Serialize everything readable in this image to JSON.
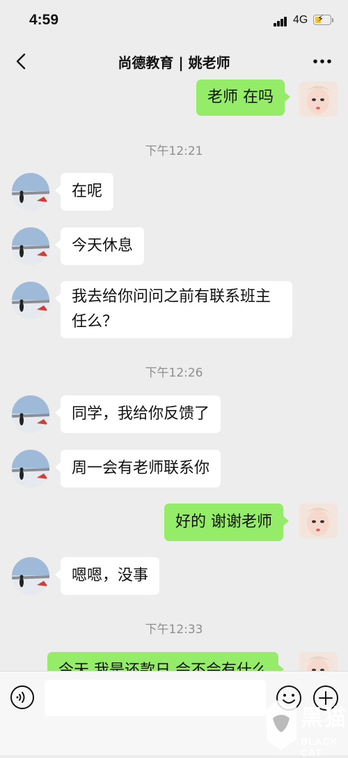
{
  "status_bar": {
    "time": "4:59",
    "network": "4G"
  },
  "nav": {
    "title": "尚德教育 | 姚老师",
    "back_icon": "chevron-left-icon",
    "more_icon": "more-dots-icon"
  },
  "messages": [
    {
      "side": "right",
      "text": "老师 在吗"
    },
    {
      "timestamp": "下午12:21"
    },
    {
      "side": "left",
      "text": "在呢"
    },
    {
      "side": "left",
      "text": "今天休息"
    },
    {
      "side": "left",
      "text_lines": [
        "我去给你问问之前有联系班主",
        "任么？"
      ]
    },
    {
      "timestamp": "下午12:26"
    },
    {
      "side": "left",
      "text": "同学，我给你反馈了"
    },
    {
      "side": "left",
      "text": "周一会有老师联系你"
    },
    {
      "side": "right",
      "text": "好的 谢谢老师"
    },
    {
      "side": "left",
      "text": "嗯嗯，没事"
    },
    {
      "timestamp": "下午12:33"
    },
    {
      "side": "right",
      "text": "今天 我是还款日 会不会有什么"
    }
  ],
  "input_bar": {
    "placeholder": "",
    "voice_icon": "voice-icon",
    "emoji_icon": "emoji-icon",
    "plus_icon": "plus-icon"
  },
  "watermark": {
    "cn": "黑猫",
    "en": "BLACK CAT"
  },
  "colors": {
    "background": "#ededed",
    "bubble_self": "#95ec69",
    "bubble_other": "#ffffff",
    "timestamp": "#8e8e8e"
  }
}
